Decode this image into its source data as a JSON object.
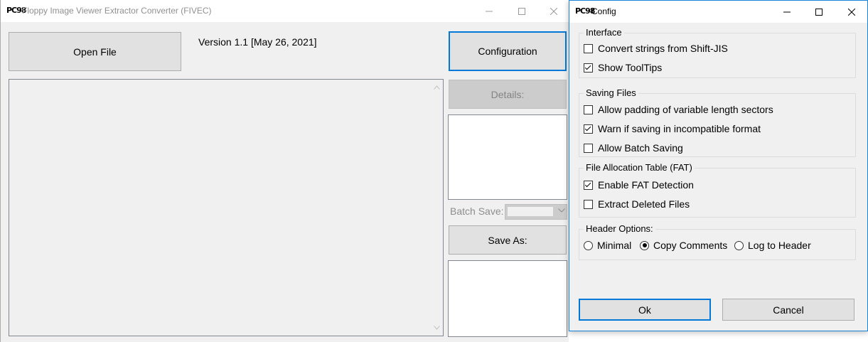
{
  "main_window": {
    "logo": "PC98",
    "title": "Floppy Image Viewer Extractor Converter (FIVEC)",
    "open_file_label": "Open File",
    "version_text": "Version  1.1 [May 26, 2021]",
    "configuration_label": "Configuration",
    "details_label": "Details:",
    "batch_save_label": "Batch Save:",
    "batch_save_value": "",
    "save_as_label": "Save As:"
  },
  "config_window": {
    "logo": "PC98",
    "title": "Config",
    "groups": {
      "interface": {
        "title": "Interface",
        "options": [
          {
            "label": "Convert strings from Shift-JIS",
            "checked": false
          },
          {
            "label": "Show ToolTips",
            "checked": true
          }
        ]
      },
      "saving": {
        "title": "Saving Files",
        "options": [
          {
            "label": "Allow padding of variable length sectors",
            "checked": false
          },
          {
            "label": "Warn if saving in incompatible format",
            "checked": true
          },
          {
            "label": "Allow Batch Saving",
            "checked": false
          }
        ]
      },
      "fat": {
        "title": "File Allocation Table (FAT)",
        "options": [
          {
            "label": "Enable FAT Detection",
            "checked": true
          },
          {
            "label": "Extract Deleted Files",
            "checked": false
          }
        ]
      },
      "header": {
        "title": "Header Options:",
        "options": [
          {
            "label": "Minimal",
            "checked": false
          },
          {
            "label": "Copy Comments",
            "checked": true
          },
          {
            "label": "Log to Header",
            "checked": false
          }
        ]
      }
    },
    "ok_label": "Ok",
    "cancel_label": "Cancel"
  },
  "colors": {
    "accent": "#0078d7",
    "window_bg": "#f0f0f0",
    "button_bg": "#e1e1e1",
    "disabled_bg": "#cccccc"
  }
}
